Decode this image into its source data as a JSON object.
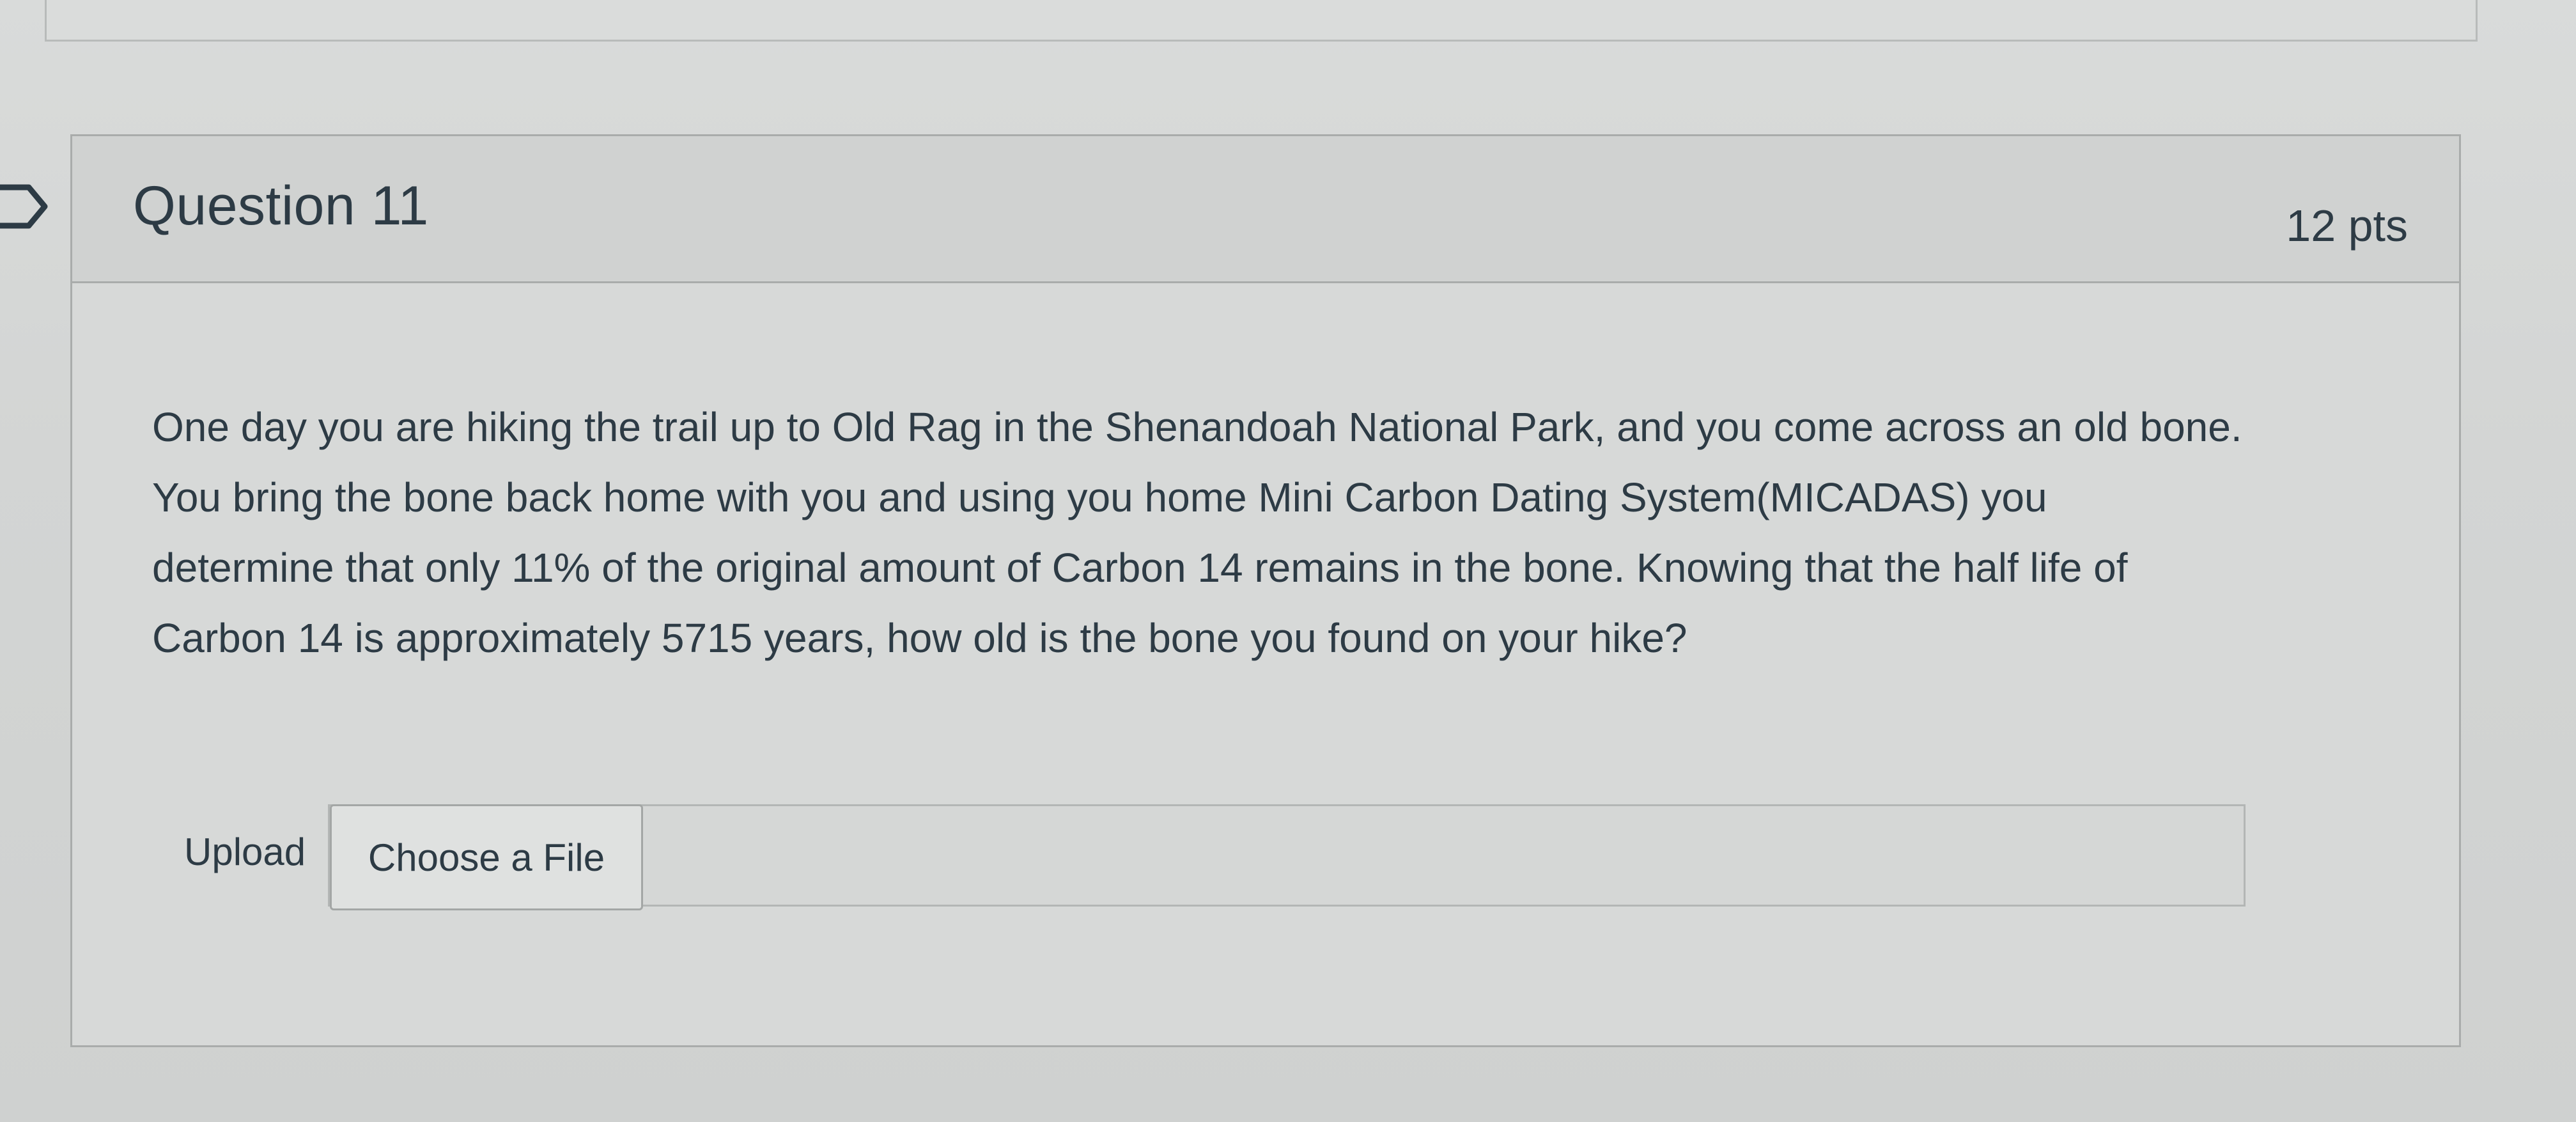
{
  "question": {
    "title": "Question 11",
    "points": "12 pts",
    "text_lines": [
      "One day you are hiking the trail up to Old Rag in the Shenandoah National Park, and you come across an old bone.",
      "You bring the bone back home with you and using you home Mini Carbon Dating System(MICADAS) you",
      "determine that only 11% of the original amount of Carbon 14 remains in the bone.  Knowing that the half life of",
      "Carbon 14 is approximately 5715 years, how old is the bone you found on your hike?"
    ]
  },
  "upload": {
    "label": "Upload",
    "button_label": "Choose a File"
  },
  "icons": {
    "flag": "flag-question-icon"
  },
  "colors": {
    "text": "#2d3b45",
    "header_bg": "#d0d2d1",
    "card_bg": "#d7d9d8",
    "border": "#a9acab"
  }
}
